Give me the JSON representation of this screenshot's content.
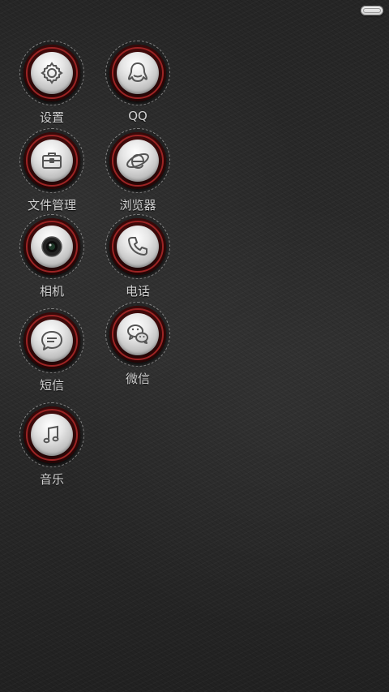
{
  "apps": [
    {
      "label": "设置",
      "icon": "gear-icon"
    },
    {
      "label": "QQ",
      "icon": "qq-penguin-icon"
    },
    {
      "label": "文件管理",
      "icon": "briefcase-icon"
    },
    {
      "label": "浏览器",
      "icon": "browser-e-icon"
    },
    {
      "label": "相机",
      "icon": "camera-lens-icon"
    },
    {
      "label": "电话",
      "icon": "phone-handset-icon"
    },
    {
      "label": "短信",
      "icon": "chat-bubble-icon"
    },
    {
      "label": "微信",
      "icon": "wechat-icon"
    },
    {
      "label": "音乐",
      "icon": "music-note-icon"
    }
  ],
  "colors": {
    "background": "#2a2a2a",
    "ring": "#9c2424",
    "label": "#d2d2d2"
  }
}
